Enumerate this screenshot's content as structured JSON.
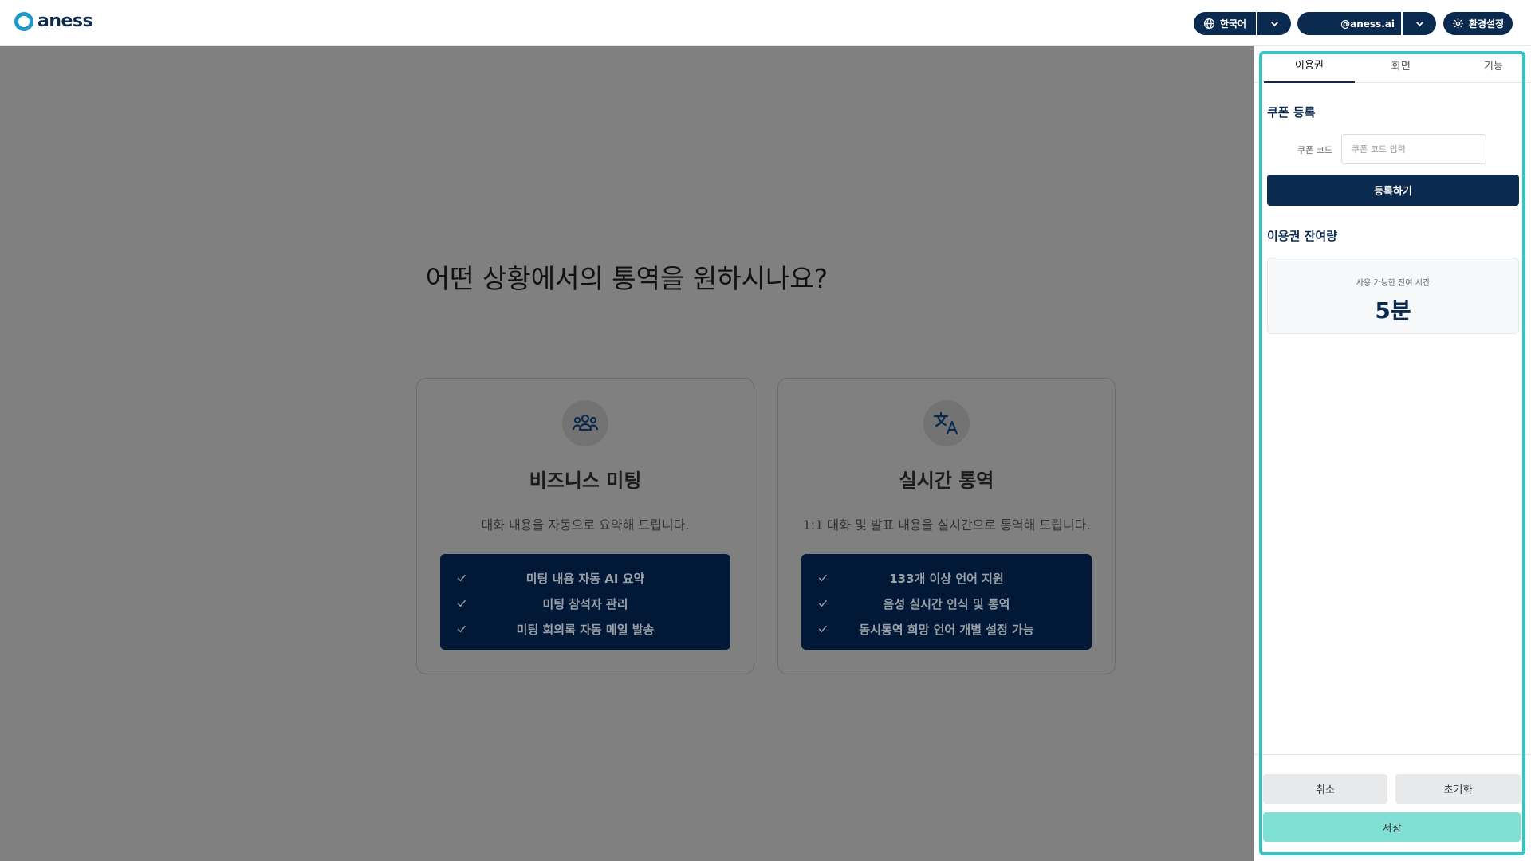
{
  "header": {
    "logo_text": "aness",
    "language_label": "한국어",
    "account_email": "@aness.ai",
    "settings_label": "환경설정"
  },
  "main": {
    "title": "어떤 상황에서의 통역을 원하시나요?",
    "cards": [
      {
        "icon": "people-group-icon",
        "title": "비즈니스 미팅",
        "description": "대화 내용을 자동으로 요약해 드립니다.",
        "features": [
          "미팅 내용 자동 AI 요약",
          "미팅 참석자 관리",
          "미팅 회의록 자동 메일 발송"
        ]
      },
      {
        "icon": "translate-icon",
        "title": "실시간 통역",
        "description": "1:1 대화 및 발표 내용을 실시간으로 통역해 드립니다.",
        "features": [
          "133개 이상 언어 지원",
          "음성 실시간 인식 및 통역",
          "동시통역 희망 언어 개별 설정 가능"
        ]
      }
    ]
  },
  "panel": {
    "tabs": [
      {
        "label": "이용권",
        "active": true
      },
      {
        "label": "화면",
        "active": false
      },
      {
        "label": "기능",
        "active": false
      }
    ],
    "coupon": {
      "section_title": "쿠폰 등록",
      "field_label": "쿠폰 코드",
      "placeholder": "쿠폰 코드 입력",
      "value": "",
      "register_label": "등록하기"
    },
    "remaining": {
      "section_title": "이용권 잔여량",
      "label": "사용 가능한 잔여 시간",
      "value": "5분"
    },
    "footer": {
      "cancel_label": "취소",
      "reset_label": "초기화",
      "save_label": "저장"
    }
  },
  "colors": {
    "brand_navy": "#0b2a4f",
    "logo_blue": "#1e98c8",
    "highlight": "#36c4c4",
    "save_button": "#7fe0d3",
    "overlay": "#808080"
  }
}
